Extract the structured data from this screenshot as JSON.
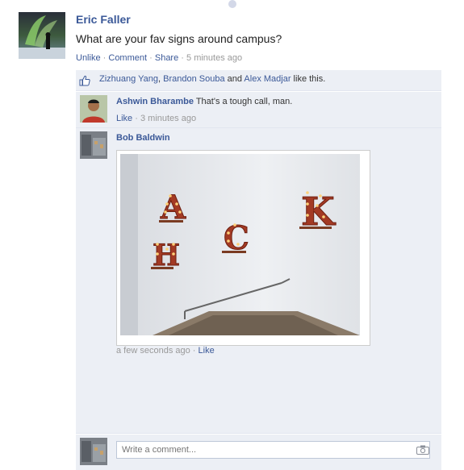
{
  "post": {
    "author": "Eric Faller",
    "text": "What are your fav signs around campus?",
    "actions": {
      "unlike": "Unlike",
      "comment": "Comment",
      "share": "Share",
      "time": "5 minutes ago"
    }
  },
  "likes": {
    "users": [
      "Zizhuang Yang",
      "Brandon Souba",
      "Alex Madjar"
    ],
    "sep": ", ",
    "and": " and ",
    "suffix": " like this."
  },
  "comments": [
    {
      "author": "Ashwin Bharambe",
      "text": "That's a tough call, man.",
      "like": "Like",
      "time": "3 minutes ago"
    },
    {
      "author": "Bob Baldwin",
      "time": "a few seconds ago",
      "like": "Like"
    }
  ],
  "composer": {
    "placeholder": "Write a comment..."
  },
  "icons": {
    "like": "thumbs-up-icon",
    "camera": "camera-icon"
  },
  "colors": {
    "link": "#3b5998",
    "ufi_bg": "#eceff5",
    "meta": "#999999"
  }
}
